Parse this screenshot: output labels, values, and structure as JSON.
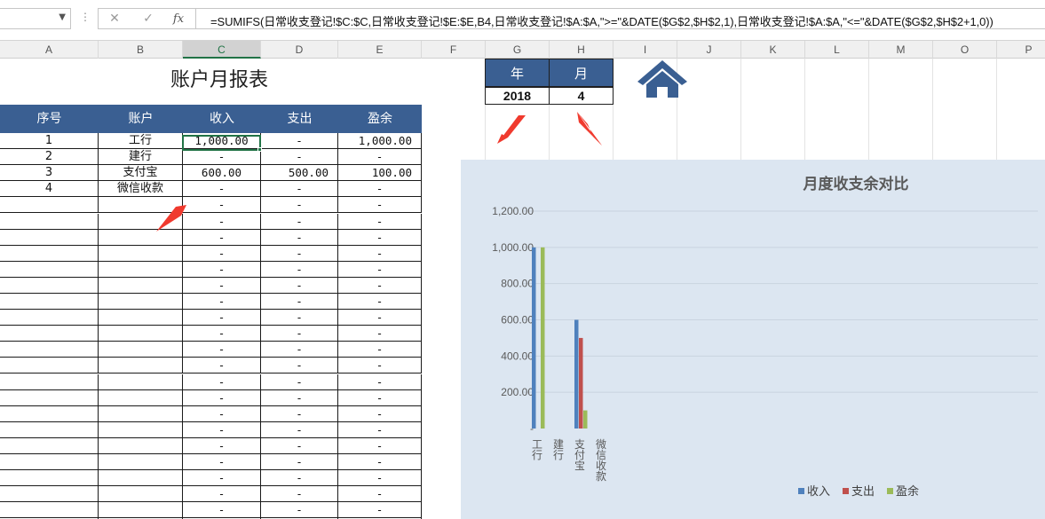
{
  "formula_bar": {
    "name_box": "",
    "cancel_icon": "✕",
    "enter_icon": "✓",
    "fx_label": "fx",
    "formula": "=SUMIFS(日常收支登记!$C:$C,日常收支登记!$E:$E,B4,日常收支登记!$A:$A,\">=\"&DATE($G$2,$H$2,1),日常收支登记!$A:$A,\"<=\"&DATE($G$2,$H$2+1,0))"
  },
  "columns": [
    "A",
    "B",
    "C",
    "D",
    "E",
    "F",
    "G",
    "H",
    "I",
    "J",
    "K",
    "L",
    "M",
    "O",
    "P"
  ],
  "active_column": "C",
  "sheet": {
    "title": "账户月报表",
    "year_label": "年",
    "month_label": "月",
    "year_value": "2018",
    "month_value": "4",
    "home_icon": "home-icon"
  },
  "table": {
    "headers": [
      "序号",
      "账户",
      "收入",
      "支出",
      "盈余"
    ],
    "rows": [
      [
        "1",
        "工行",
        "1,000.00",
        "-",
        "1,000.00"
      ],
      [
        "2",
        "建行",
        "-",
        "-",
        "-"
      ],
      [
        "3",
        "支付宝",
        "600.00",
        "500.00",
        "100.00"
      ],
      [
        "4",
        "微信收款",
        "-",
        "-",
        "-"
      ],
      [
        "",
        "",
        "-",
        "-",
        "-"
      ],
      [
        "",
        "",
        "-",
        "-",
        "-"
      ],
      [
        "",
        "",
        "-",
        "-",
        "-"
      ],
      [
        "",
        "",
        "-",
        "-",
        "-"
      ],
      [
        "",
        "",
        "-",
        "-",
        "-"
      ],
      [
        "",
        "",
        "-",
        "-",
        "-"
      ],
      [
        "",
        "",
        "-",
        "-",
        "-"
      ],
      [
        "",
        "",
        "-",
        "-",
        "-"
      ],
      [
        "",
        "",
        "-",
        "-",
        "-"
      ],
      [
        "",
        "",
        "-",
        "-",
        "-"
      ],
      [
        "",
        "",
        "-",
        "-",
        "-"
      ],
      [
        "",
        "",
        "-",
        "-",
        "-"
      ],
      [
        "",
        "",
        "-",
        "-",
        "-"
      ],
      [
        "",
        "",
        "-",
        "-",
        "-"
      ],
      [
        "",
        "",
        "-",
        "-",
        "-"
      ],
      [
        "",
        "",
        "-",
        "-",
        "-"
      ],
      [
        "",
        "",
        "-",
        "-",
        "-"
      ],
      [
        "",
        "",
        "-",
        "-",
        "-"
      ],
      [
        "",
        "",
        "-",
        "-",
        "-"
      ],
      [
        "",
        "",
        "-",
        "-",
        "-"
      ],
      [
        "",
        "",
        "-",
        "-",
        "-"
      ]
    ]
  },
  "colors": {
    "header_blue": "#3a5f92",
    "chart_bg": "#dce6f1",
    "income": "#4f81bd",
    "expense": "#c0504d",
    "surplus": "#9bbb59",
    "arrow_red": "#f03a2e"
  },
  "chart_data": {
    "type": "bar",
    "title": "月度收支余对比",
    "categories": [
      "工行",
      "建行",
      "支付宝",
      "微信收款"
    ],
    "series": [
      {
        "name": "收入",
        "values": [
          1000,
          0,
          600,
          0
        ]
      },
      {
        "name": "支出",
        "values": [
          0,
          0,
          500,
          0
        ]
      },
      {
        "name": "盈余",
        "values": [
          1000,
          0,
          100,
          0
        ]
      }
    ],
    "y_ticks": [
      "-",
      "200.00",
      "400.00",
      "600.00",
      "800.00",
      "1,000.00",
      "1,200.00"
    ],
    "ylim": [
      0,
      1200
    ],
    "grid": true,
    "legend_position": "bottom-right"
  }
}
